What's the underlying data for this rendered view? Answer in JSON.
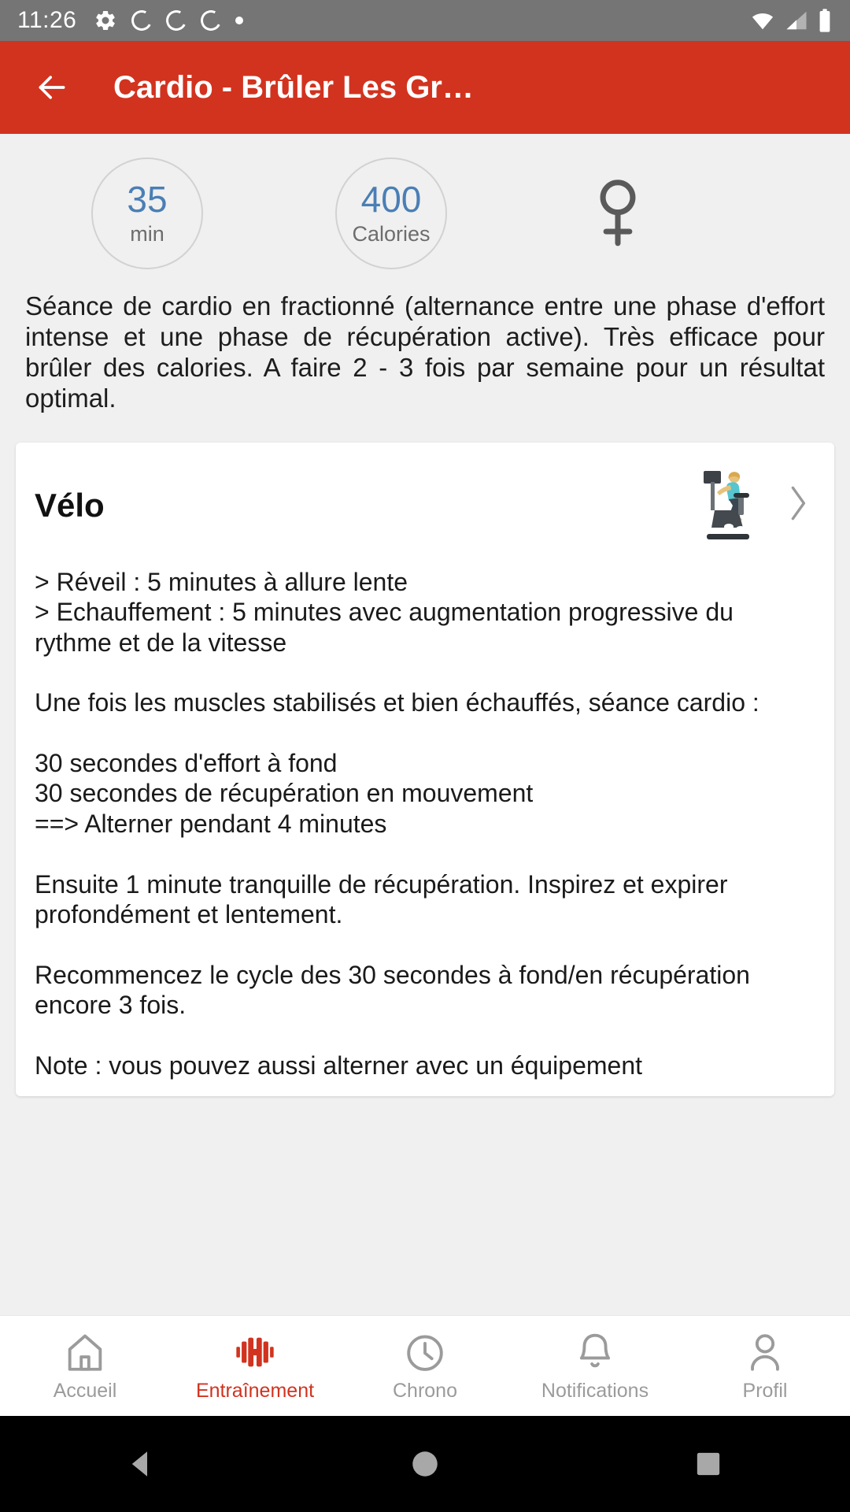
{
  "status_bar": {
    "time": "11:26",
    "left_icons": [
      "gear-icon",
      "c-circle-icon",
      "c-circle-icon",
      "c-circle-icon",
      "dot-icon"
    ],
    "right_icons": [
      "wifi-icon",
      "signal-icon",
      "battery-icon"
    ]
  },
  "app_bar": {
    "back_label": "←",
    "title": "Cardio - Brûler Les Gr…",
    "background_color": "#D1331F"
  },
  "stats": {
    "duration": {
      "value": "35",
      "label": "min"
    },
    "calories": {
      "value": "400",
      "label": "Calories"
    },
    "gender_icon": "female-icon",
    "value_color": "#4A7FB5"
  },
  "description": "Séance de cardio en fractionné (alternance entre une phase d'effort intense et une phase de récupération active). Très efficace pour brûler des calories. A faire 2 - 3 fois par semaine pour un résultat optimal.",
  "exercise_card": {
    "title": "Vélo",
    "thumbnail_icon": "exercise-bike-image",
    "chevron_icon": "chevron-right-icon",
    "body": "> Réveil : 5 minutes à allure lente\n> Echauffement : 5 minutes avec augmentation progressive du rythme et de la vitesse\n\nUne fois les muscles stabilisés et bien échauffés, séance cardio :\n\n30 secondes d'effort à fond\n30 secondes de récupération en mouvement\n==> Alterner pendant 4 minutes\n\nEnsuite 1 minute tranquille de récupération. Inspirez et expirer profondément et lentement.\n\nRecommencez le cycle des 30 secondes à fond/en récupération encore 3 fois.\n\nNote : vous pouvez aussi alterner avec un équipement"
  },
  "bottom_nav": {
    "active_color": "#D1331F",
    "inactive_color": "#9b9b9b",
    "items": [
      {
        "label": "Accueil",
        "icon": "home-icon",
        "active": false
      },
      {
        "label": "Entraînement",
        "icon": "dumbbell-icon",
        "active": true
      },
      {
        "label": "Chrono",
        "icon": "clock-icon",
        "active": false
      },
      {
        "label": "Notifications",
        "icon": "bell-icon",
        "active": false
      },
      {
        "label": "Profil",
        "icon": "person-icon",
        "active": false
      }
    ]
  },
  "system_nav": {
    "buttons": [
      "back-triangle-icon",
      "home-circle-icon",
      "recents-square-icon"
    ]
  }
}
